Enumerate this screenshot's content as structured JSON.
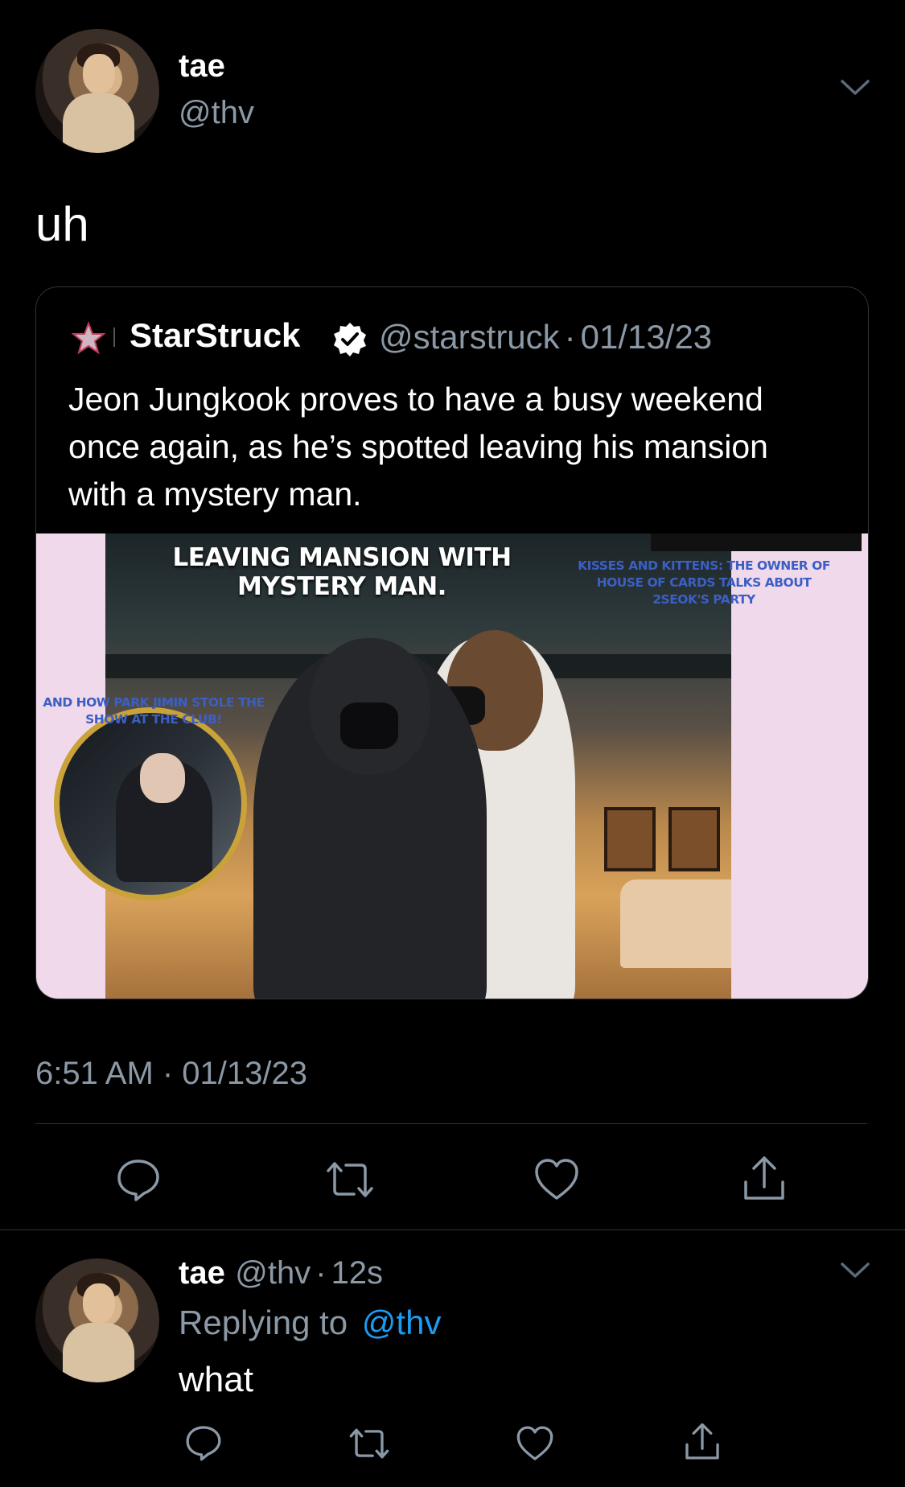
{
  "tweet": {
    "author_name": "tae",
    "author_handle": "@thv",
    "text": "uh",
    "timestamp": "6:51 AM · 01/13/23"
  },
  "quoted": {
    "name": "StarStruck",
    "handle": "@starstruck",
    "separator": "·",
    "date": "01/13/23",
    "text": "Jeon Jungkook proves to have a busy weekend once again, as he’s spotted leaving his mansion with a mystery man.",
    "image": {
      "headline": "LEAVING MANSION WITH MYSTERY MAN.",
      "side_right": "KISSES AND KITTENS: THE OWNER OF HOUSE OF CARDS TALKS ABOUT 2SEOK'S PARTY",
      "side_left": "AND HOW PARK JIMIN STOLE THE SHOW AT THE CLUB!"
    }
  },
  "actions": [
    "reply-icon",
    "retweet-icon",
    "like-icon",
    "share-icon"
  ],
  "reply": {
    "author_name": "tae",
    "author_handle": "@thv",
    "separator": "·",
    "time": "12s",
    "replying_prefix": "Replying to",
    "replying_handle": "@thv",
    "text": "what"
  },
  "colors": {
    "background": "#000000",
    "secondary_text": "#8b98a5",
    "link": "#1d9bf0",
    "divider": "#2f3336",
    "icon": "#8b98a5"
  }
}
